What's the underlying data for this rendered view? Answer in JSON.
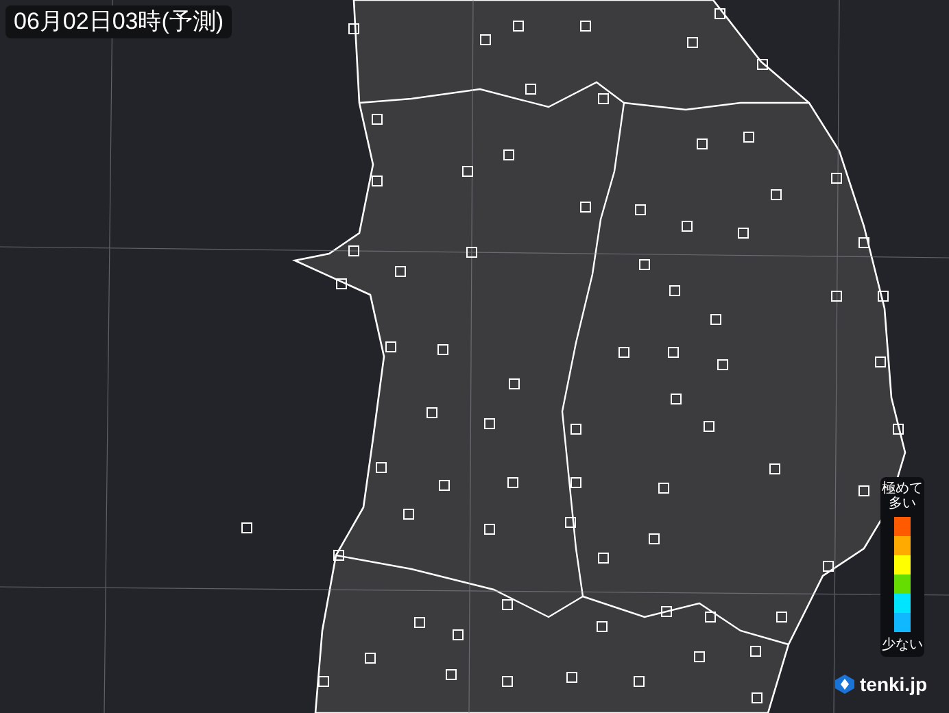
{
  "title": "06月02日03時(予測)",
  "legend": {
    "top_label": "極めて多い",
    "bottom_label": "少ない",
    "swatches": [
      {
        "color": "#ff5a00"
      },
      {
        "color": "#ffaa00"
      },
      {
        "color": "#ffff00"
      },
      {
        "color": "#66dd00"
      },
      {
        "color": "#00e5ff"
      },
      {
        "color": "#10b8ff"
      }
    ]
  },
  "logo": {
    "text": "tenki.jp"
  }
}
